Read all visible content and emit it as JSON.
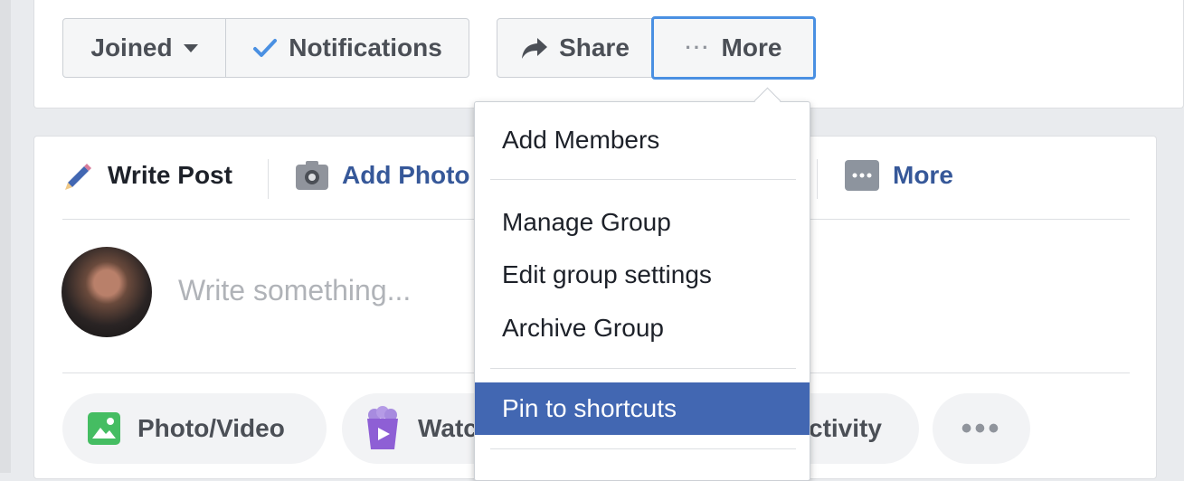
{
  "header": {
    "joined_label": "Joined",
    "notifications_label": "Notifications",
    "share_label": "Share",
    "more_label": "More"
  },
  "composer": {
    "tabs": [
      {
        "label": "Write Post"
      },
      {
        "label": "Add Photo"
      },
      {
        "label": "More"
      }
    ],
    "placeholder": "Write something...",
    "actions": [
      {
        "label": "Photo/Video"
      },
      {
        "label": "Watc"
      },
      {
        "label": "ctivity"
      }
    ]
  },
  "dropdown": {
    "items": [
      {
        "label": "Add Members"
      },
      {
        "label": "Manage Group"
      },
      {
        "label": "Edit group settings"
      },
      {
        "label": "Archive Group"
      },
      {
        "label": "Pin to shortcuts",
        "highlighted": true
      }
    ]
  },
  "colors": {
    "accent": "#4267b2",
    "link": "#365899",
    "focus_ring": "#4a90e2",
    "check": "#4a90e2"
  },
  "icons": [
    "caret-down-icon",
    "checkmark-icon",
    "share-arrow-icon",
    "ellipsis-icon",
    "pencil-icon",
    "camera-icon",
    "more-square-icon",
    "photo-icon",
    "watch-party-icon",
    "more-dots-icon"
  ]
}
